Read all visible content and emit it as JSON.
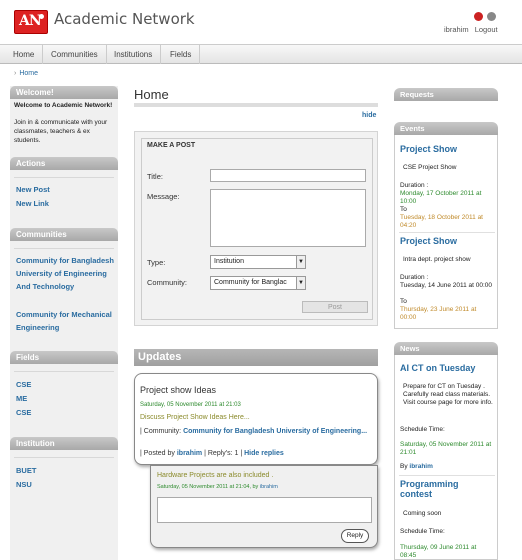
{
  "header": {
    "logo_text": "AN",
    "app_title": "Academic Network",
    "user_name": "ibrahim",
    "logout_label": "Logout",
    "colors": {
      "logo": "#d22222",
      "link": "#2a6ca0",
      "date_green": "#2d8a2d"
    }
  },
  "nav": {
    "items": [
      "Home",
      "Communities",
      "Institutions",
      "Fields"
    ]
  },
  "breadcrumb": {
    "current": "Home"
  },
  "sidebar": {
    "welcome_head": "Welcome!",
    "welcome_title": "Welcome to Academic Network!",
    "welcome_text": "Join in & communicate with your classmates, teachers & ex students.",
    "actions_head": "Actions",
    "actions": [
      "New Post",
      "New Link"
    ],
    "communities_head": "Communities",
    "communities": [
      "Community for Bangladesh University of Engineering And Technology",
      "Community for Mechanical Engineering"
    ],
    "fields_head": "Fields",
    "fields": [
      "CSE",
      "ME",
      "CSE"
    ],
    "institution_head": "Institution",
    "institutions": [
      "BUET",
      "NSU"
    ]
  },
  "main": {
    "title": "Home",
    "hide_label": "hide",
    "make_post": {
      "heading": "MAKE A POST",
      "title_label": "Title:",
      "message_label": "Message:",
      "type_label": "Type:",
      "type_value": "Institution",
      "community_label": "Community:",
      "community_value": "Community for Banglac",
      "post_button": "Post"
    },
    "updates_head": "Updates",
    "update": {
      "title": "Project show Ideas",
      "date": "Saturday, 05 November 2011 at 21:03",
      "desc": "Discuss Project Show Ideas Here...",
      "community_prefix": "| Community:",
      "community_name": "Community for Bangladesh University of Engineering...",
      "posted_by_prefix": "| Posted by",
      "author": "ibrahim",
      "replys": "| Reply's: 1 |",
      "hide_replies": "Hide replies"
    },
    "reply": {
      "text": "Hardware Projects are also included .",
      "date": "Saturday, 05 November 2011 at 21:04, by",
      "author": "ibrahim",
      "button": "Reply"
    }
  },
  "right": {
    "requests_head": "Requests",
    "events_head": "Events",
    "events": [
      {
        "title": "Project Show",
        "desc": "CSE Project Show",
        "duration_label": "Duration :",
        "start": "Monday, 17 October 2011 at 10:00",
        "to_label": "To",
        "end": "Tuesday, 18 October 2011 at 04:20"
      },
      {
        "title": "Project Show",
        "desc": "Intra dept. project show",
        "duration_label": "Duration :",
        "start": "Tuesday, 14 June 2011 at 00:00",
        "to_label": "To",
        "end": "Thursday, 23 June 2011 at 00:00"
      }
    ],
    "news_head": "News",
    "news": [
      {
        "title": "AI CT on Tuesday",
        "desc": "Prepare for CT on Tuesday . Carefully read class materials. Visit course page for more info.",
        "schedule_label": "Schedule Time:",
        "time": "Saturday, 05 November 2011 at 21:01",
        "by_label": "By",
        "author": "ibrahim"
      },
      {
        "title": "Programming contest",
        "desc": "Coming soon",
        "schedule_label": "Schedule Time:",
        "time": "Thursday, 09 June 2011 at 08:45"
      }
    ]
  }
}
